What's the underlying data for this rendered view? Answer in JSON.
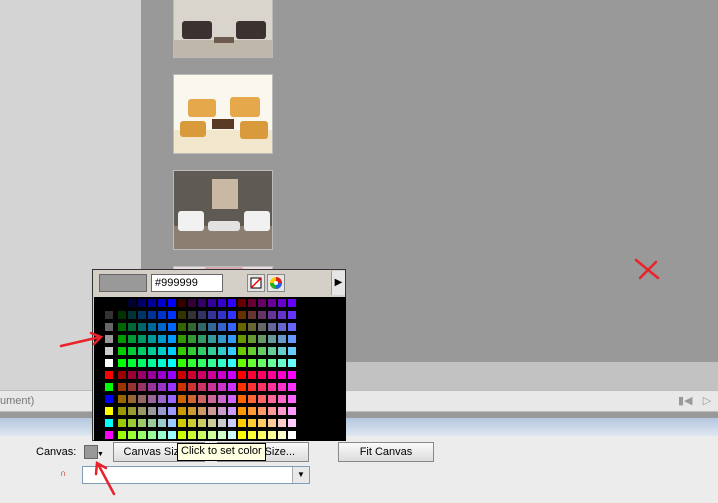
{
  "colors": {
    "current": "#999999",
    "accent_annotation": "#e8232b"
  },
  "thumbnails": [
    {
      "name": "living-room-photo-1",
      "wall": "#d9d4cc",
      "floor": "#bfb7aa",
      "sofa": "#3b3131"
    },
    {
      "name": "living-room-photo-2",
      "wall": "#faf7ef",
      "floor": "#f2e6cc",
      "sofa": "#e5a84a"
    },
    {
      "name": "living-room-photo-3",
      "wall": "#5f5a53",
      "floor": "#8b7f72",
      "sofa": "#f1f1f1"
    },
    {
      "name": "living-room-photo-4",
      "wall": "#eadde0",
      "floor": "#eadde0",
      "sofa": "#d9a8b2"
    }
  ],
  "status": {
    "text": "ument)"
  },
  "picker": {
    "hex_value": "#999999",
    "no_color_icon": "no-color-icon",
    "system_color_icon": "color-wheel-icon",
    "more_icon": "triangle-right-icon"
  },
  "properties": {
    "canvas_label": "Canvas:",
    "canvas_size_label": "Canvas Size...",
    "image_size_label": "Image Size...",
    "fit_canvas_label": "Fit Canvas",
    "dropdown_value": ""
  },
  "tooltip": {
    "text": "Click to set color"
  }
}
